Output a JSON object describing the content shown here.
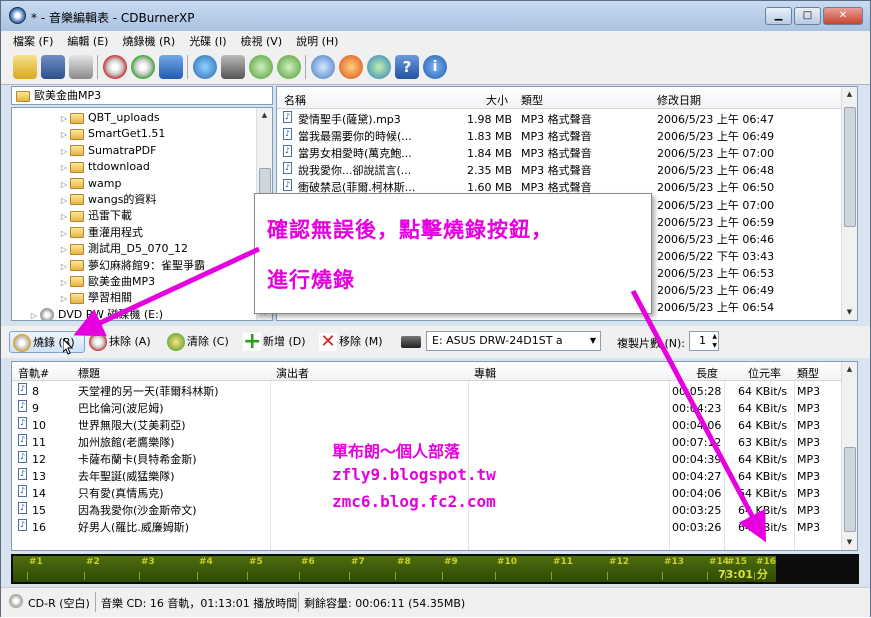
{
  "window": {
    "title": "* - 音樂編輯表 - CDBurnerXP",
    "min_label": "▁",
    "max_label": "□",
    "close_label": "✕"
  },
  "menu": [
    "檔案 (F)",
    "編輯 (E)",
    "燒錄機 (R)",
    "光碟 (I)",
    "檢視 (V)",
    "說明 (H)"
  ],
  "current_folder": "歐美金曲MP3",
  "tree": [
    "QBT_uploads",
    "SmartGet1.51",
    "SumatraPDF",
    "ttdownload",
    "wamp",
    "wangs的資料",
    "迅雷下載",
    "重灌用程式",
    "測試用_D5_070_12",
    "夢幻麻將館9：雀聖爭霸",
    "歐美金曲MP3",
    "學習相關",
    "DVD RW 磁碟機 (E:)"
  ],
  "file_columns": {
    "name": "名稱",
    "size": "大小",
    "type": "類型",
    "date": "修改日期"
  },
  "files": [
    {
      "name": "愛情聖手(薩黛).mp3",
      "size": "1.98 MB",
      "type": "MP3 格式聲音",
      "date": "2006/5/23 上午 06:47"
    },
    {
      "name": "當我最需要你的時候(...",
      "size": "1.83 MB",
      "type": "MP3 格式聲音",
      "date": "2006/5/23 上午 06:49"
    },
    {
      "name": "當男女相愛時(萬克鮑...",
      "size": "1.84 MB",
      "type": "MP3 格式聲音",
      "date": "2006/5/23 上午 07:00"
    },
    {
      "name": "說我愛你...卻說謊言(...",
      "size": "2.35 MB",
      "type": "MP3 格式聲音",
      "date": "2006/5/23 上午 06:48"
    },
    {
      "name": "衝破禁忌(菲爾.柯林斯...",
      "size": "1.60 MB",
      "type": "MP3 格式聲音",
      "date": "2006/5/23 上午 06:50"
    },
    {
      "name": "",
      "size": "",
      "type": "",
      "date": "2006/5/23 上午 07:00"
    },
    {
      "name": "",
      "size": "",
      "type": "",
      "date": "2006/5/23 上午 06:59"
    },
    {
      "name": "",
      "size": "",
      "type": "",
      "date": "2006/5/23 上午 06:46"
    },
    {
      "name": "",
      "size": "",
      "type": "",
      "date": "2006/5/22 下午 03:43"
    },
    {
      "name": "",
      "size": "",
      "type": "",
      "date": "2006/5/23 上午 06:53"
    },
    {
      "name": "",
      "size": "",
      "type": "",
      "date": "2006/5/23 上午 06:49"
    },
    {
      "name": "",
      "size": "",
      "type": "",
      "date": "2006/5/23 上午 06:54"
    }
  ],
  "controls": {
    "burn": "燒錄 (B)",
    "erase": "抹除 (A)",
    "clear": "清除 (C)",
    "add": "新增 (D)",
    "remove": "移除 (M)",
    "drive": "E: ASUS DRW-24D1ST   a",
    "copies_label": "複製片數 (N):",
    "copies_value": "1"
  },
  "track_columns": {
    "num": "音軌#",
    "title": "標題",
    "artist": "演出者",
    "album": "專輯",
    "length": "長度",
    "bitrate": "位元率",
    "type": "類型"
  },
  "tracks": [
    {
      "num": "8",
      "title": "天堂裡的另一天(菲爾科林斯)",
      "length": "00:05:28",
      "bitrate": "64 KBit/s",
      "type": "MP3"
    },
    {
      "num": "9",
      "title": "巴比倫河(波尼姆)",
      "length": "00:04:23",
      "bitrate": "64 KBit/s",
      "type": "MP3"
    },
    {
      "num": "10",
      "title": "世界無限大(艾美莉亞)",
      "length": "00:04:06",
      "bitrate": "64 KBit/s",
      "type": "MP3"
    },
    {
      "num": "11",
      "title": "加州旅館(老鷹樂隊)",
      "length": "00:07:12",
      "bitrate": "63 KBit/s",
      "type": "MP3"
    },
    {
      "num": "12",
      "title": "卡薩布蘭卡(貝特希金斯)",
      "length": "00:04:39",
      "bitrate": "64 KBit/s",
      "type": "MP3"
    },
    {
      "num": "13",
      "title": "去年聖誕(威猛樂隊)",
      "length": "00:04:27",
      "bitrate": "64 KBit/s",
      "type": "MP3"
    },
    {
      "num": "14",
      "title": "只有愛(真情馬克)",
      "length": "00:04:06",
      "bitrate": "64 KBit/s",
      "type": "MP3"
    },
    {
      "num": "15",
      "title": "因為我愛你(沙金斯帝文)",
      "length": "00:03:25",
      "bitrate": "64 KBit/s",
      "type": "MP3"
    },
    {
      "num": "16",
      "title": "好男人(羅比.威廉姆斯)",
      "length": "00:03:26",
      "bitrate": "64 KBit/s",
      "type": "MP3"
    }
  ],
  "timeline": {
    "labels": [
      "#1",
      "#2",
      "#3",
      "#4",
      "#5",
      "#6",
      "#7",
      "#8",
      "#9",
      "#10",
      "#11",
      "#12",
      "#13",
      "#14",
      "#15",
      "#16"
    ],
    "time": "73:01 分",
    "fill_fraction": 0.905
  },
  "status": {
    "disc": "CD-R (空白)",
    "music": "音樂 CD: 16 音軌，01:13:01 播放時間",
    "remaining": "剩餘容量: 00:06:11 (54.35MB)"
  },
  "annotation": {
    "line1": "確認無誤後，點擊燒錄按鈕，",
    "line2": "進行燒錄"
  },
  "watermark": {
    "line1": "單布朗～個人部落",
    "line2": "zfly9.blogspot.tw",
    "line3": "zmc6.blog.fc2.com"
  }
}
